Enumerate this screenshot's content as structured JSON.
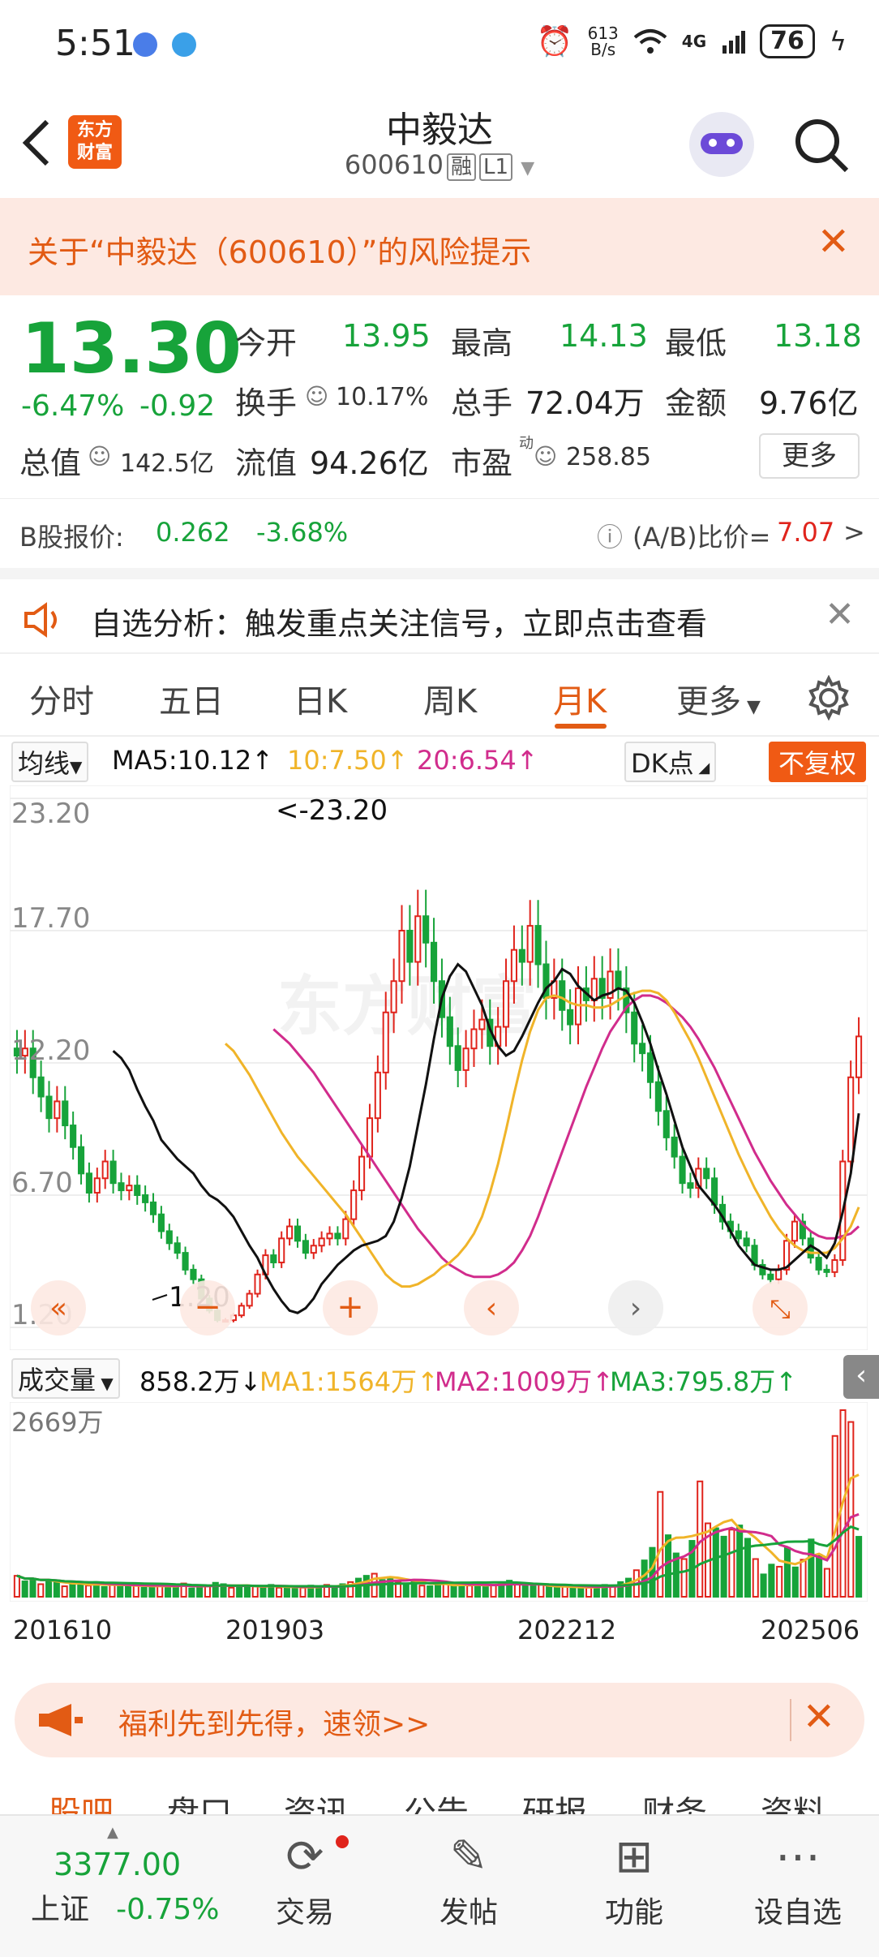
{
  "status_bar": {
    "time": "5:51",
    "net_speed": "613\nB/s",
    "net_speed_top": "613",
    "net_speed_bottom": "B/s",
    "signal": "4G",
    "battery": "76"
  },
  "header": {
    "logo_text_1": "东方",
    "logo_text_2": "财富",
    "stock_name": "中毅达",
    "stock_code": "600610",
    "tag_rong": "融",
    "tag_level": "L1"
  },
  "risk_banner": {
    "text": "关于“中毅达（600610）”的风险提示"
  },
  "quote": {
    "price": "13.30",
    "change_pct": "-6.47%",
    "change": "-0.92",
    "open_label": "今开",
    "open": "13.95",
    "high_label": "最高",
    "high": "14.13",
    "low_label": "最低",
    "low": "13.18",
    "turnover_label": "换手",
    "turnover": "10.17%",
    "volume_label": "总手",
    "volume": "72.04万",
    "amount_label": "金额",
    "amount": "9.76亿",
    "mktcap_label": "总值",
    "mktcap": "142.5亿",
    "float_label": "流值",
    "float_cap": "94.26亿",
    "pe_label": "市盈",
    "pe_sup": "动",
    "pe": "258.85",
    "more_label": "更多"
  },
  "bshare": {
    "label": "B股报价:",
    "price": "0.262",
    "change_pct": "-3.68%",
    "ratio_label": "(A/B)比价=",
    "ratio": "7.07",
    "arrow": ">"
  },
  "analysis": {
    "text": "自选分析：触发重点关注信号，立即点击查看"
  },
  "tabs": [
    "分时",
    "五日",
    "日K",
    "周K",
    "月K",
    "更多"
  ],
  "active_tab": "月K",
  "ma_bar": {
    "selector": "均线",
    "ma5": "MA5:10.12↑",
    "ma10": "10:7.50↑",
    "ma20": "20:6.54↑",
    "dk": "DK点",
    "fq": "不复权"
  },
  "colors": {
    "up": "#e0241c",
    "down": "#17a33a",
    "accent": "#e25b14",
    "ma5": "#111111",
    "ma10": "#f0b429",
    "ma20": "#d12c8c"
  },
  "chart_data": {
    "type": "candlestick",
    "y_ticks": [
      "23.20",
      "17.70",
      "12.20",
      "6.70",
      "1.20"
    ],
    "ylim": [
      1.2,
      23.2
    ],
    "max_label": "<-23.20",
    "min_label": "1.20",
    "x_ticks": [
      "201610",
      "201903",
      "202212",
      "202506"
    ],
    "close": [
      12.5,
      12.8,
      11.6,
      10.8,
      9.9,
      10.6,
      9.6,
      8.7,
      7.6,
      6.8,
      7.4,
      8.1,
      7.2,
      6.9,
      7.1,
      6.7,
      6.4,
      5.9,
      5.2,
      4.7,
      4.3,
      3.6,
      3.2,
      2.4,
      1.9,
      1.5,
      1.5,
      1.7,
      2.1,
      2.6,
      3.4,
      4.2,
      3.9,
      4.9,
      5.4,
      4.8,
      4.3,
      4.6,
      4.9,
      5.1,
      4.9,
      5.7,
      6.9,
      8.3,
      9.9,
      11.8,
      14.3,
      15.6,
      17.7,
      16.4,
      18.3,
      17.2,
      15.6,
      14.1,
      12.9,
      11.9,
      12.8,
      13.6,
      14.0,
      12.9,
      13.7,
      15.6,
      16.9,
      16.4,
      17.9,
      16.3,
      14.9,
      15.6,
      14.4,
      13.8,
      15.3,
      14.8,
      15.7,
      14.9,
      16.0,
      15.3,
      14.3,
      13.0,
      12.6,
      11.4,
      10.2,
      9.1,
      8.3,
      7.2,
      7.0,
      7.8,
      7.4,
      6.3,
      5.6,
      5.2,
      4.9,
      4.6,
      3.8,
      3.4,
      3.2,
      3.6,
      4.8,
      5.6,
      4.9,
      4.1,
      3.6,
      3.5,
      4.0,
      8.1,
      11.6,
      13.3
    ],
    "ma5": [
      12.7,
      12.4,
      11.9,
      11.1,
      10.4,
      9.8,
      9.0,
      8.6,
      8.2,
      7.9,
      7.6,
      7.1,
      6.7,
      6.5,
      6.2,
      5.8,
      5.2,
      4.6,
      4.1,
      3.4,
      2.8,
      2.3,
      1.9,
      1.8,
      2.0,
      2.4,
      3.0,
      3.4,
      3.8,
      4.1,
      4.4,
      4.6,
      4.7,
      4.8,
      5.0,
      5.6,
      6.6,
      7.9,
      9.6,
      11.3,
      13.2,
      14.9,
      15.8,
      16.3,
      16.0,
      15.3,
      14.6,
      13.6,
      12.9,
      12.5,
      12.7,
      13.3,
      14.0,
      14.7,
      15.3,
      15.6,
      16.1,
      15.9,
      15.4,
      15.1,
      14.8,
      15.0,
      15.1,
      15.3,
      15.2,
      14.7,
      13.9,
      13.0,
      11.9,
      10.9,
      9.8,
      8.7,
      7.9,
      7.1,
      6.7,
      6.3,
      5.8,
      5.2,
      4.6,
      4.2,
      3.8,
      3.7,
      3.6,
      3.6,
      3.7,
      4.0,
      4.3,
      4.6,
      4.4,
      4.1,
      4.7,
      6.0,
      7.6,
      10.1
    ],
    "ma10": [
      13.0,
      12.7,
      12.2,
      11.7,
      11.1,
      10.5,
      9.9,
      9.3,
      8.8,
      8.3,
      7.9,
      7.5,
      7.1,
      6.7,
      6.3,
      5.9,
      5.4,
      4.9,
      4.4,
      3.9,
      3.4,
      3.1,
      2.9,
      2.9,
      3.0,
      3.2,
      3.4,
      3.7,
      3.9,
      4.2,
      4.6,
      5.1,
      5.8,
      6.8,
      8.0,
      9.4,
      10.9,
      12.3,
      13.5,
      14.4,
      14.9,
      15.0,
      14.9,
      14.7,
      14.6,
      14.6,
      14.5,
      14.5,
      14.6,
      14.8,
      15.0,
      15.1,
      15.2,
      15.2,
      15.1,
      14.8,
      14.3,
      13.7,
      13.1,
      12.4,
      11.6,
      10.8,
      10.0,
      9.2,
      8.4,
      7.7,
      7.0,
      6.4,
      5.8,
      5.3,
      4.9,
      4.6,
      4.4,
      4.3,
      4.3,
      4.3,
      4.5,
      4.9,
      5.4,
      6.2
    ],
    "ma20": [
      13.6,
      13.3,
      13.0,
      12.6,
      12.2,
      11.8,
      11.3,
      10.8,
      10.3,
      9.8,
      9.3,
      8.8,
      8.3,
      7.8,
      7.3,
      6.8,
      6.3,
      5.8,
      5.3,
      4.9,
      4.5,
      4.1,
      3.8,
      3.6,
      3.4,
      3.3,
      3.3,
      3.3,
      3.4,
      3.6,
      3.9,
      4.4,
      5.0,
      5.8,
      6.7,
      7.6,
      8.5,
      9.4,
      10.3,
      11.2,
      12.0,
      12.8,
      13.5,
      14.0,
      14.5,
      14.8,
      15.0,
      15.0,
      14.9,
      14.7,
      14.4,
      14.1,
      13.7,
      13.2,
      12.6,
      12.0,
      11.3,
      10.6,
      9.9,
      9.2,
      8.5,
      7.9,
      7.3,
      6.8,
      6.3,
      5.9,
      5.5,
      5.2,
      5.0,
      4.9,
      4.9,
      5.0,
      5.1,
      5.4
    ]
  },
  "volume_bar": {
    "selector": "成交量",
    "value": "858.2万↓",
    "ma1": "MA1:1564万↑",
    "ma2": "MA2:1009万↑",
    "ma3": "MA3:795.8万↑",
    "max_label": "2669万"
  },
  "volume_data": [
    300,
    220,
    260,
    180,
    240,
    200,
    150,
    190,
    170,
    160,
    210,
    140,
    180,
    160,
    150,
    170,
    130,
    150,
    170,
    140,
    160,
    190,
    120,
    140,
    150,
    200,
    180,
    130,
    140,
    160,
    150,
    140,
    170,
    130,
    120,
    140,
    130,
    160,
    150,
    170,
    130,
    180,
    210,
    260,
    300,
    330,
    240,
    280,
    210,
    190,
    230,
    160,
    150,
    180,
    190,
    150,
    170,
    160,
    190,
    150,
    170,
    200,
    230,
    180,
    160,
    150,
    170,
    140,
    130,
    150,
    120,
    140,
    130,
    150,
    170,
    160,
    210,
    260,
    380,
    520,
    700,
    1500,
    880,
    620,
    540,
    800,
    1650,
    1050,
    980,
    860,
    960,
    1020,
    830,
    540,
    320,
    460,
    430,
    700,
    420,
    530,
    820,
    600,
    400,
    2300,
    2669,
    2500,
    858
  ],
  "promo": {
    "text": "福利先到先得，速领>>"
  },
  "subtabs": [
    "股吧",
    "盘口",
    "资讯",
    "公告",
    "研报",
    "财务",
    "资料"
  ],
  "bottom_nav": {
    "index_value": "3377.00",
    "index_name": "上证",
    "index_change": "-0.75%",
    "items": [
      "交易",
      "发帖",
      "功能",
      "设自选"
    ]
  }
}
